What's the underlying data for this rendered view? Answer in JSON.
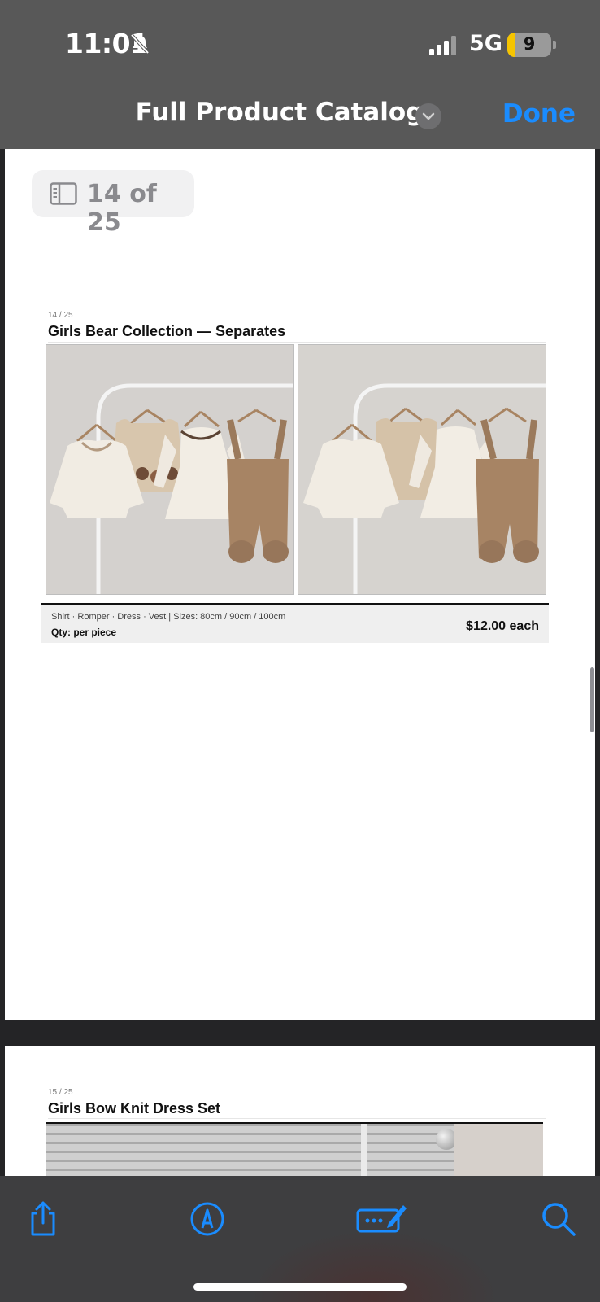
{
  "status_bar": {
    "time": "11:01",
    "network": "5G",
    "battery_level": "9"
  },
  "nav": {
    "title": "Full Product Catalog",
    "done_label": "Done"
  },
  "page_indicator": "14 of 25",
  "current_page": {
    "index_label": "14 / 25",
    "title": "Girls Bear Collection — Separates",
    "description": "Shirt · Romper · Dress · Vest | Sizes: 80cm / 90cm / 100cm",
    "qty": "Qty: per piece",
    "price": "$12.00 each"
  },
  "next_page": {
    "index_label": "15 / 25",
    "title": "Girls Bow Knit Dress Set"
  },
  "toolbar": {
    "icons": [
      "share-icon",
      "markup-icon",
      "form-fill-icon",
      "search-icon"
    ]
  },
  "colors": {
    "accent": "#1a8cff",
    "header_bg": "#585858",
    "doc_bg": "#242426"
  }
}
